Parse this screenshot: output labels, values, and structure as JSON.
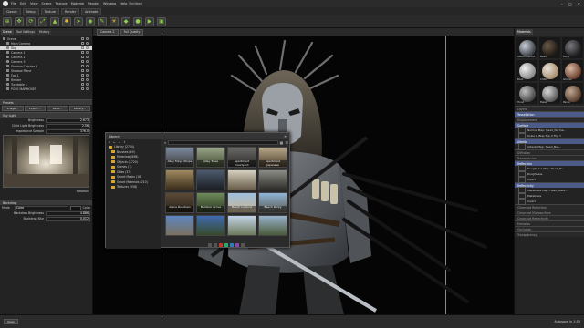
{
  "window": {
    "title": "Untitled",
    "menu": [
      "File",
      "Edit",
      "View",
      "Scene",
      "Texture",
      "Material",
      "Render",
      "Window",
      "Help"
    ]
  },
  "toolbar_tabs": [
    "Classic",
    "Setup",
    "Texture",
    "Render",
    "Animate"
  ],
  "left_panel": {
    "tabs": [
      "Scene",
      "Tool Settings",
      "History"
    ],
    "tree": [
      {
        "label": "Scene",
        "selected": false
      },
      {
        "label": "Main Camera",
        "selected": false
      },
      {
        "label": "Sky",
        "selected": true
      },
      {
        "label": "Camera 1",
        "selected": false
      },
      {
        "label": "Camera 2",
        "selected": false
      },
      {
        "label": "Camera 3",
        "selected": false
      },
      {
        "label": "Shadow Catcher 1",
        "selected": false
      },
      {
        "label": "Shadow Plane",
        "selected": false
      },
      {
        "label": "Fog 1",
        "selected": false
      },
      {
        "label": "Render",
        "selected": false
      },
      {
        "label": "Turntable 1",
        "selected": false
      },
      {
        "label": "POSE MARMOSET",
        "selected": false
      }
    ],
    "sky_section": "Presets",
    "buttons": [
      "Image...",
      "Export...",
      "Save...",
      "Library..."
    ],
    "skylight_label": "Sky Light",
    "props": [
      {
        "label": "Brightness",
        "value": "2.673",
        "fill": 0.35
      },
      {
        "label": "Child Light Brightness",
        "value": "2.56",
        "fill": 0.3
      },
      {
        "label": "Importance Sample",
        "value": "376.0",
        "fill": 0.45
      }
    ],
    "rotation_label": "Rotation",
    "backdrop_label": "Backdrop",
    "backdrop": {
      "mode_label": "Mode",
      "mode_value": "Color",
      "color_label": "Color",
      "brightness_label": "Backdrop Brightness",
      "brightness_value": "4.886",
      "blur_label": "Backdrop Blur",
      "blur_value": "0.012"
    }
  },
  "viewport": {
    "camera": "Camera 2",
    "quality": "Full Quality"
  },
  "library": {
    "title": "Library",
    "tree": [
      {
        "label": "Library (2724)",
        "sub": false
      },
      {
        "label": "Brushes (49)",
        "sub": true
      },
      {
        "label": "Materials (898)",
        "sub": true
      },
      {
        "label": "Objects (1720)",
        "sub": true
      },
      {
        "label": "Scenes (7)",
        "sub": true
      },
      {
        "label": "Skies (37)",
        "sub": true
      },
      {
        "label": "Smart Masks (18)",
        "sub": true
      },
      {
        "label": "Smart Materials (210)",
        "sub": true
      },
      {
        "label": "Textures (558)",
        "sub": true
      }
    ],
    "thumbs": [
      {
        "label": "Alley Tokyo Shops",
        "bg": "linear-gradient(#7b8aa0,#3c3a35)"
      },
      {
        "label": "Alley Trees",
        "bg": "linear-gradient(#9aa68a,#3f4a30)"
      },
      {
        "label": "Apartment Courtyard",
        "bg": "linear-gradient(#6a6a68,#2a2826)"
      },
      {
        "label": "Apartment Japanese",
        "bg": "linear-gradient(#b8a88a,#4b3d2b)"
      },
      {
        "label": "",
        "bg": "linear-gradient(#a08a60,#3b2e1c)"
      },
      {
        "label": "",
        "bg": "linear-gradient(#4b5a6d,#1c1f24)"
      },
      {
        "label": "",
        "bg": "linear-gradient(#d6d0c0,#6a5e4a)"
      },
      {
        "label": "",
        "bg": "linear-gradient(#8c8c86,#2f2e2a)"
      },
      {
        "label": "Arena Rundown",
        "bg": "linear-gradient(#5c4a36,#24201a)"
      },
      {
        "label": "Bamboo Grove",
        "bg": "linear-gradient(#6f8a5a,#2a3820)"
      },
      {
        "label": "Beach Lookout",
        "bg": "linear-gradient(#9fc0e0,#c8b490)"
      },
      {
        "label": "Beach Rocky",
        "bg": "linear-gradient(#8fb4d8,#5a5a50)"
      },
      {
        "label": "",
        "bg": "linear-gradient(#5d86c0,#7a7060)"
      },
      {
        "label": "",
        "bg": "linear-gradient(#3f6ab0,#384a2a)"
      },
      {
        "label": "",
        "bg": "linear-gradient(#c2d4e8,#6d7a5a)"
      },
      {
        "label": "",
        "bg": "linear-gradient(#98b2cc,#4a5a3a)"
      }
    ]
  },
  "right_panel": {
    "title": "Materials",
    "materials": [
      {
        "label": "Attachments1",
        "color": "radial-gradient(circle at 35% 35%,#c9d0d8,#3c4046 70%)"
      },
      {
        "label": "Belts",
        "color": "radial-gradient(circle at 35% 35%,#6a5a48,#1e1914 70%)"
      },
      {
        "label": "Body",
        "color": "radial-gradient(circle at 35% 35%,#7a7a80,#202022 70%)"
      },
      {
        "label": "Boot",
        "color": "radial-gradient(circle at 35% 35%,#f0f0f0,#8a8a8a 70%)"
      },
      {
        "label": "Cloth",
        "color": "radial-gradient(circle at 35% 35%,#e8e0d8,#a89070 70%)"
      },
      {
        "label": "Gloves",
        "color": "radial-gradient(circle at 35% 35%,#d8b8a0,#6a4030 70%)"
      },
      {
        "label": "Hood",
        "color": "radial-gradient(circle at 35% 35%,#bfbfbf,#4a4a4a 70%)"
      },
      {
        "label": "Mask",
        "color": "radial-gradient(circle at 35% 35%,#d8d8d8,#5a5a5a 70%)"
      },
      {
        "label": "Pants",
        "color": "radial-gradient(circle at 35% 35%,#c0a890,#5a4030 70%)"
      }
    ],
    "sections": [
      {
        "label": "Layers",
        "style": "dim"
      },
      {
        "label": "Tessellation",
        "style": "hl"
      },
      {
        "label": "Displacement",
        "style": "dim"
      },
      {
        "label": "Surface",
        "style": "hl"
      },
      {
        "label": "Normal Map: Head_Norma...",
        "style": "row"
      },
      {
        "label": "Scale & Bias   Flip X   Flip Y",
        "style": "row"
      },
      {
        "label": "Albedo",
        "style": "hl"
      },
      {
        "label": "Albedo Map: Head_Bas...",
        "style": "row"
      },
      {
        "label": "Diffusion",
        "style": "dim"
      },
      {
        "label": "Transmission",
        "style": "dim"
      },
      {
        "label": "Reflection",
        "style": "hl"
      },
      {
        "label": "Roughness Map: Head_Ro...",
        "style": "row"
      },
      {
        "label": "Roughness",
        "style": "row"
      },
      {
        "label": "Invert",
        "style": "row"
      },
      {
        "label": "Reflectivity",
        "style": "hl"
      },
      {
        "label": "Metalness Map: Head_Meta...",
        "style": "row"
      },
      {
        "label": "Metalness",
        "style": "row"
      },
      {
        "label": "Invert",
        "style": "row"
      },
      {
        "label": "Clearcoat Reflection",
        "style": "dim"
      },
      {
        "label": "Clearcoat Microsurface",
        "style": "dim"
      },
      {
        "label": "Clearcoat Reflectivity",
        "style": "dim"
      },
      {
        "label": "Emission",
        "style": "dim"
      },
      {
        "label": "Occlusion",
        "style": "dim"
      },
      {
        "label": "Transparency",
        "style": "dim"
      }
    ]
  },
  "status": {
    "left": "Clear",
    "right": "Autosave in 1:55"
  }
}
